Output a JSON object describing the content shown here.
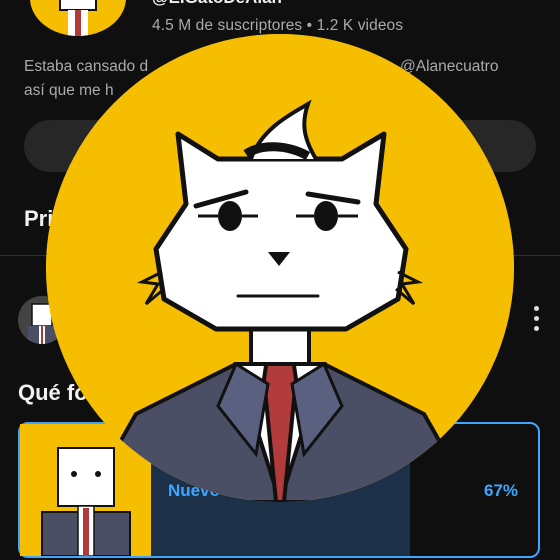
{
  "channel": {
    "handle": "@ElGatoDeAlan",
    "stats": "4.5 M de suscriptores  •  1.2 K videos",
    "description_start": "Estaba cansado d",
    "description_mention": "@Alanecuatro",
    "description_line2": "así que me h"
  },
  "sections": {
    "heading_partial": "Pri",
    "poll_heading_partial": "Qué fo"
  },
  "poll": {
    "option_label": "Nuevo",
    "option_percent": "67%",
    "fill_fraction": 0.67
  },
  "colors": {
    "background": "#0f0f0f",
    "avatar_bg": "#f6be00",
    "accent_blue": "#3ea6ff",
    "muted_text": "#aaaaaa"
  },
  "icons": [
    "more-vert-icon",
    "cat-avatar"
  ]
}
